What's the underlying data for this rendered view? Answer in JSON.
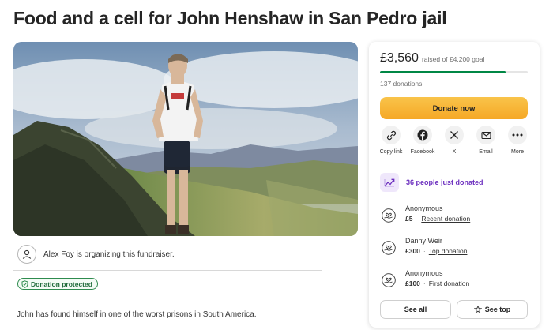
{
  "page": {
    "title": "Food and a cell for John Henshaw in San Pedro jail"
  },
  "hero": {
    "image": "photo of a man in a white t-shirt and dark shorts standing on a mountain ridge"
  },
  "organizer": {
    "icon": "person-icon",
    "text": "Alex Foy is organizing this fundraiser."
  },
  "badge": {
    "icon": "shield-icon",
    "label": "Donation protected",
    "color": "#2e8b4e"
  },
  "story": {
    "excerpt": "John has found himself in one of the worst prisons in South America."
  },
  "donation_panel": {
    "raised": "£3,560",
    "goal_text": "raised of £4,200 goal",
    "progress_fraction": 0.8476,
    "donations_text": "137 donations",
    "donate_label": "Donate now",
    "share": [
      {
        "icon": "link-icon",
        "label": "Copy link"
      },
      {
        "icon": "facebook-icon",
        "label": "Facebook"
      },
      {
        "icon": "x-icon",
        "label": "X"
      },
      {
        "icon": "mail-icon",
        "label": "Email"
      },
      {
        "icon": "more-icon",
        "label": "More"
      }
    ],
    "just_donated": {
      "icon": "trending-icon",
      "text": "36 people just donated"
    },
    "donors": [
      {
        "name": "Anonymous",
        "amount": "£5",
        "tag": "Recent donation",
        "icon": "heart-hand-icon"
      },
      {
        "name": "Danny Weir",
        "amount": "£300",
        "tag": "Top donation",
        "icon": "heart-hand-icon"
      },
      {
        "name": "Anonymous",
        "amount": "£100",
        "tag": "First donation",
        "icon": "heart-hand-icon"
      }
    ],
    "see_all_label": "See all",
    "see_top_label": "See top",
    "colors": {
      "accent_green": "#008745",
      "donate_orange": "#f5a826",
      "purple": "#6c2fbf"
    }
  }
}
